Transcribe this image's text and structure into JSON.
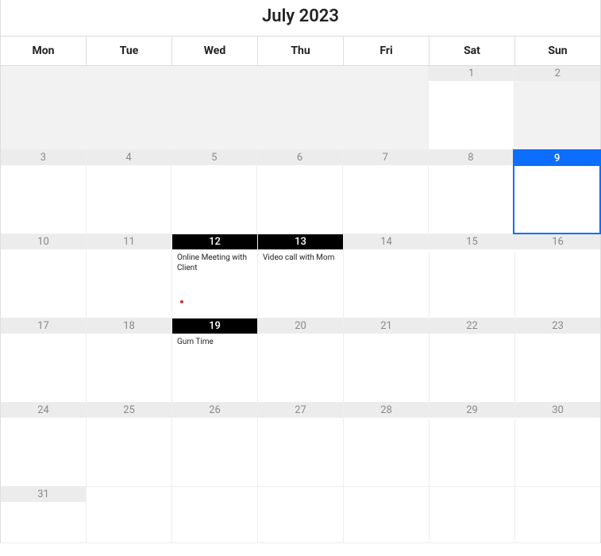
{
  "title": "July 2023",
  "weekdays": [
    "Mon",
    "Tue",
    "Wed",
    "Thu",
    "Fri",
    "Sat",
    "Sun"
  ],
  "selected_day": 9,
  "events": {
    "12": "Online Meeting with Client",
    "13": "Video call with Mom",
    "19": "Gum Time"
  },
  "event_days": [
    12,
    13,
    19
  ],
  "dot_days": [
    12
  ],
  "days": {
    "d1": "1",
    "d2": "2",
    "d3": "3",
    "d4": "4",
    "d5": "5",
    "d6": "6",
    "d7": "7",
    "d8": "8",
    "d9": "9",
    "d10": "10",
    "d11": "11",
    "d12": "12",
    "d13": "13",
    "d14": "14",
    "d15": "15",
    "d16": "16",
    "d17": "17",
    "d18": "18",
    "d19": "19",
    "d20": "20",
    "d21": "21",
    "d22": "22",
    "d23": "23",
    "d24": "24",
    "d25": "25",
    "d26": "26",
    "d27": "27",
    "d28": "28",
    "d29": "29",
    "d30": "30",
    "d31": "31"
  }
}
